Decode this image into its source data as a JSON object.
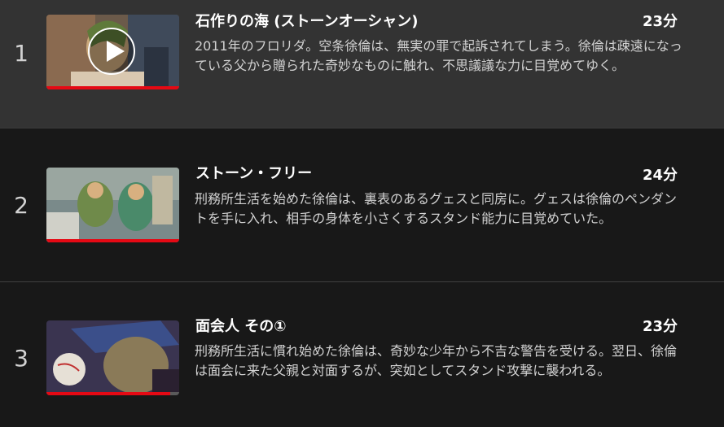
{
  "episodes": [
    {
      "index": "1",
      "title": "石作りの海 (ストーンオーシャン)",
      "duration": "23分",
      "synopsis": "2011年のフロリダ。空条徐倫は、無実の罪で起訴されてしまう。徐倫は疎遠になっている父から贈られた奇妙なものに触れ、不思議議な力に目覚めてゆく。",
      "progress": 1.0,
      "active": true
    },
    {
      "index": "2",
      "title": "ストーン・フリー",
      "duration": "24分",
      "synopsis": "刑務所生活を始めた徐倫は、裏表のあるグェスと同房に。グェスは徐倫のペンダントを手に入れ、相手の身体を小さくするスタンド能力に目覚めていた。",
      "progress": 1.0,
      "active": false
    },
    {
      "index": "3",
      "title": "面会人 その①",
      "duration": "23分",
      "synopsis": "刑務所生活に慣れ始めた徐倫は、奇妙な少年から不吉な警告を受ける。翌日、徐倫は面会に来た父親と対面するが、突如としてスタンド攻撃に襲われる。",
      "progress": 0.93,
      "active": false
    }
  ],
  "colors": {
    "progress": "#e50914",
    "active_row": "#333333",
    "background": "#181818"
  },
  "icons": {
    "play": "play-icon"
  }
}
